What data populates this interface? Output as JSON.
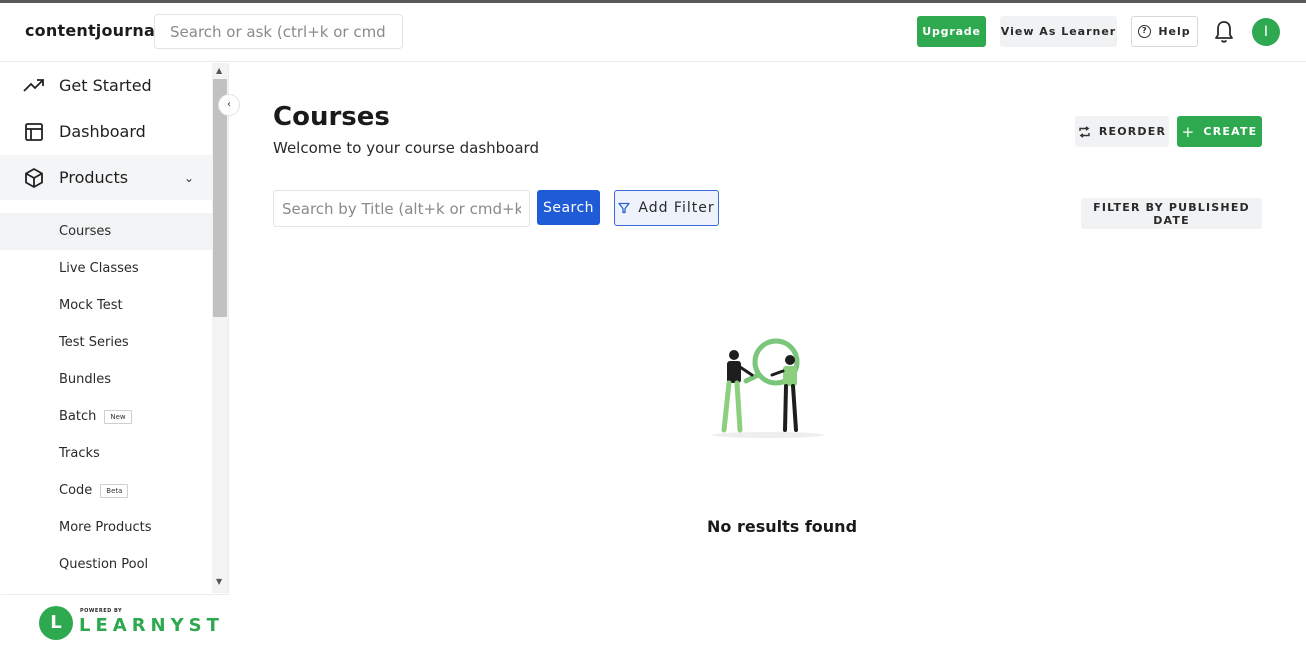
{
  "header": {
    "brand": "contentjournal",
    "search_placeholder": "Search or ask (ctrl+k or cmd+k)",
    "upgrade_label": "Upgrade",
    "view_as_learner_label": "View As Learner",
    "help_label": "Help",
    "avatar_initial": "I"
  },
  "sidebar": {
    "items": [
      {
        "label": "Get Started",
        "icon": "trend-line-icon"
      },
      {
        "label": "Dashboard",
        "icon": "layout-icon"
      },
      {
        "label": "Products",
        "icon": "box-icon"
      }
    ],
    "sub_items": [
      {
        "label": "Courses"
      },
      {
        "label": "Live Classes"
      },
      {
        "label": "Mock Test"
      },
      {
        "label": "Test Series"
      },
      {
        "label": "Bundles"
      },
      {
        "label": "Batch",
        "badge": "New"
      },
      {
        "label": "Tracks"
      },
      {
        "label": "Code",
        "badge": "Beta"
      },
      {
        "label": "More Products"
      },
      {
        "label": "Question Pool"
      }
    ],
    "footer_small": "POWERED BY",
    "footer_brand": "LEARNYST",
    "footer_logo_letter": "L"
  },
  "main": {
    "title": "Courses",
    "subtitle": "Welcome to your course dashboard",
    "reorder_label": "REORDER",
    "create_label": "CREATE",
    "title_search_placeholder": "Search by Title (alt+k or cmd+k)",
    "search_button_label": "Search",
    "add_filter_label": "Add Filter",
    "filter_published_label": "FILTER BY PUBLISHED DATE",
    "empty_message": "No results found"
  },
  "colors": {
    "accent_green": "#2ea94f",
    "primary_blue": "#1f5bd6"
  }
}
